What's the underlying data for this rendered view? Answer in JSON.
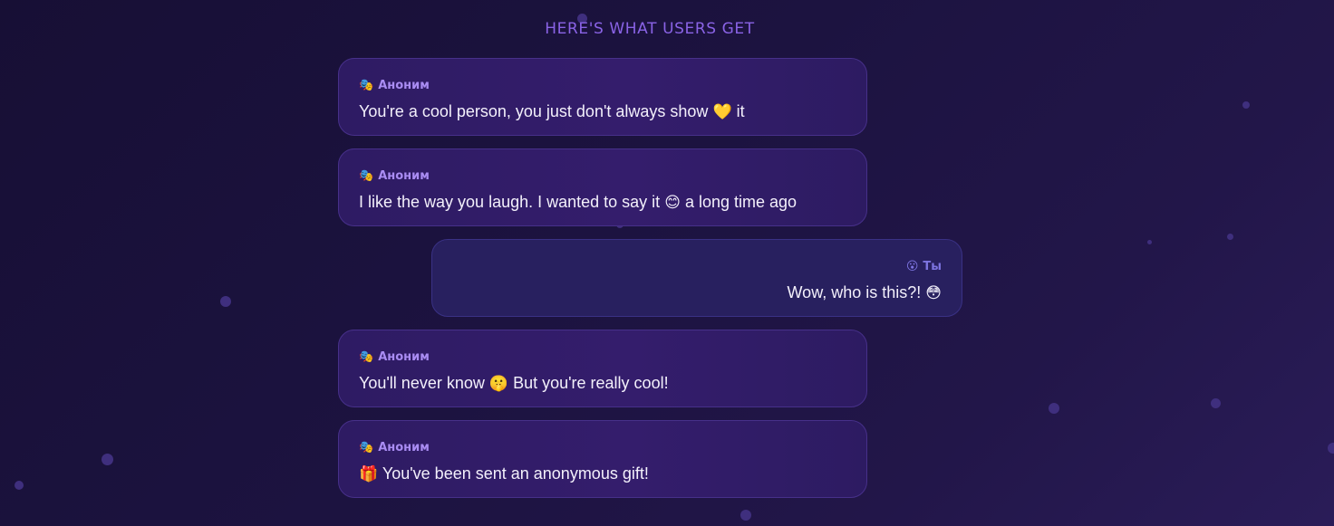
{
  "heading": "HERE'S WHAT USERS GET",
  "messages": [
    {
      "sender": "Аноним",
      "sender_icon": "theater-masks-icon",
      "sender_emoji": "🎭",
      "text_before": "You're a cool person, you just don't always show",
      "emoji": "💛",
      "text_after": "it"
    },
    {
      "sender": "Аноним",
      "sender_icon": "theater-masks-icon",
      "sender_emoji": "🎭",
      "text_before": "I like the way you laugh. I wanted to say it",
      "emoji": "😊",
      "text_after": "a long time ago"
    },
    {
      "sender": "Ты",
      "sender_icon": "surprised-face-icon",
      "sender_emoji": "😮",
      "text_before": "Wow, who is this?!",
      "emoji": "😳",
      "text_after": ""
    },
    {
      "sender": "Аноним",
      "sender_icon": "theater-masks-icon",
      "sender_emoji": "🎭",
      "text_before": "You'll never know",
      "emoji": "🤫",
      "text_after": "But you're really cool!"
    },
    {
      "sender": "Аноним",
      "sender_icon": "theater-masks-icon",
      "sender_emoji": "🎭",
      "text_before": "",
      "emoji": "🎁",
      "text_after": "You've been sent an anonymous gift!"
    }
  ],
  "colors": {
    "heading": "#8a63e6",
    "anon_sender": "#a98cf2",
    "own_sender": "#7d74e0",
    "message_text": "#f3f0fb",
    "anon_bubble": "#331d6a",
    "own_bubble": "#28205f"
  }
}
